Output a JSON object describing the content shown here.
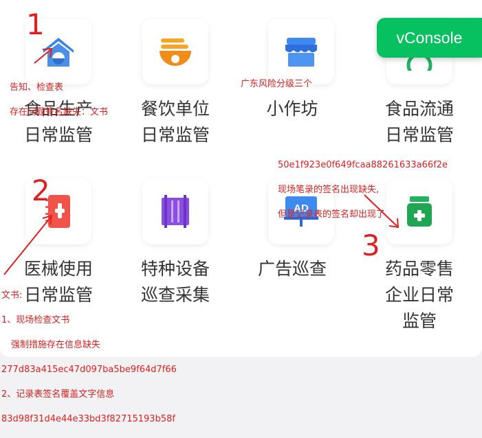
{
  "tiles": [
    {
      "line1": "食品生产",
      "line2": "日常监管",
      "icon": "home-shield-icon"
    },
    {
      "line1": "餐饮单位",
      "line2": "日常监管",
      "icon": "noodle-bowl-icon"
    },
    {
      "line1": "小作坊",
      "icon": "storefront-icon"
    },
    {
      "line1": "食品流通",
      "line2": "日常监管",
      "icon": "circulation-icon"
    },
    {
      "line1": "医械使用",
      "line2": "日常监管",
      "icon": "medical-device-book-icon"
    },
    {
      "line1": "特种设备",
      "line2": "巡查采集",
      "icon": "special-equipment-icon"
    },
    {
      "line1": "广告巡查",
      "icon": "ad-board-icon",
      "ad_text": "AD"
    },
    {
      "line1": "药品零售",
      "line2": "企业日常",
      "line3": "监管",
      "icon": "medicine-jar-icon"
    }
  ],
  "vconsole": "vConsole",
  "annotations": {
    "n1": "1",
    "n2": "2",
    "n3": "3",
    "note1_line1": "告知、检查表",
    "note1_line2": "存在问题签名缺失：文书",
    "note_workshop": "广东风险分级三个",
    "note3_hash": "50e1f923e0f649fcaa88261633a66f2e",
    "note3_line2": "现场笔录的签名出现缺失,",
    "note3_line3": "但是记录表的签名却出现了",
    "note2_title": "文书:",
    "note2_line1": "1、现场检查文书",
    "note2_line2": "强制措施存在信息缺失",
    "note2_hash1": "277d83a415ec47d097ba5be9f64d7f66",
    "note2_line3": "2、记录表签名覆盖文字信息",
    "note2_hash2": "83d98f31d4e44e33bd3f82715193b58f"
  },
  "colors": {
    "accent_green": "#07c160",
    "annotation_red": "#e02020",
    "text": "#333333"
  }
}
